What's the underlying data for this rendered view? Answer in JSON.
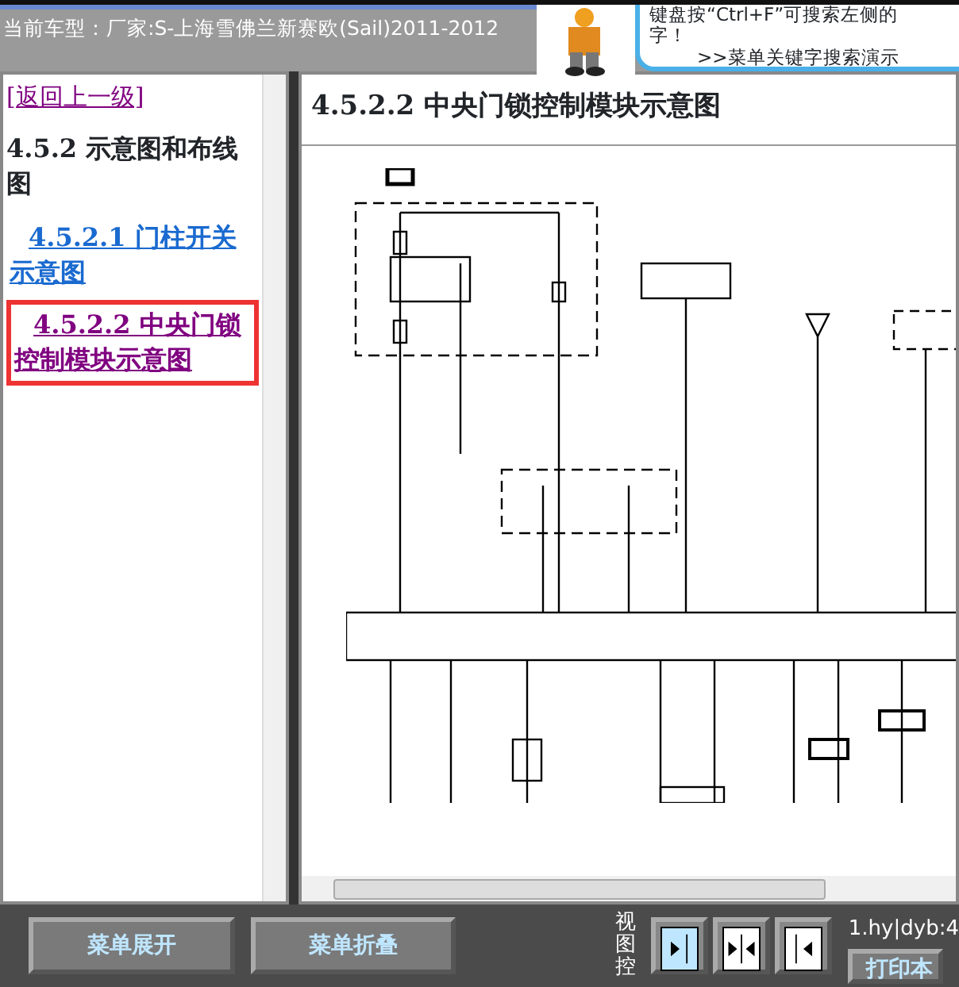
{
  "header": {
    "vehicle": "当前车型：厂家:S-上海雪佛兰新赛欧(Sail)2011-2012",
    "notice_line_1": "键盘按“Ctrl+F”可搜索左侧的",
    "notice_line_2": "字！",
    "notice_link": ">>菜单关键字搜索演示"
  },
  "sidebar": {
    "items": [
      {
        "kind": "back",
        "text": "[返回上一级]"
      },
      {
        "kind": "heading",
        "text": "4.5.2 示意图和布线图"
      },
      {
        "kind": "link",
        "text": "4.5.2.1 门柱开关示意图",
        "selected": false
      },
      {
        "kind": "link",
        "text": "4.5.2.2 中央门锁控制模块示意图",
        "selected": true
      }
    ]
  },
  "content": {
    "title": "4.5.2.2 中央门锁控制模块示意图"
  },
  "footer": {
    "buttons": [
      "菜单展开",
      "菜单折叠"
    ],
    "view_label": "视图控",
    "view_buttons": [
      {
        "kind": "right",
        "selected": true
      },
      {
        "kind": "both",
        "selected": false
      },
      {
        "kind": "left",
        "selected": false
      }
    ],
    "info": "1.hy|dyb:4",
    "print_button": "打印本"
  }
}
